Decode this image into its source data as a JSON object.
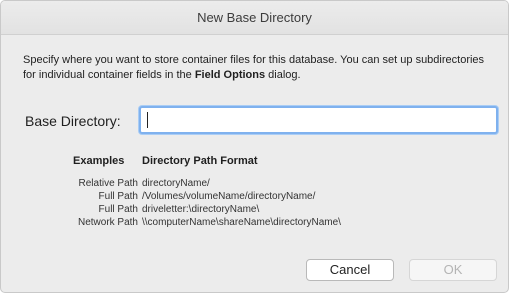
{
  "dialog": {
    "title": "New Base Directory",
    "description_part1": "Specify where you want to store container files for this database. You can set up subdirectories for individual container fields in the ",
    "description_bold": "Field Options",
    "description_part2": " dialog."
  },
  "base_directory": {
    "label": "Base Directory:",
    "value": ""
  },
  "examples": {
    "header_label": "Examples",
    "header_format": "Directory Path Format",
    "rows": [
      {
        "type": "Relative Path",
        "format": "directoryName/"
      },
      {
        "type": "Full Path",
        "format": "/Volumes/volumeName/directoryName/"
      },
      {
        "type": "Full Path",
        "format": "driveletter:\\directoryName\\"
      },
      {
        "type": "Network Path",
        "format": "\\\\computerName\\shareName\\directoryName\\"
      }
    ]
  },
  "buttons": {
    "cancel_label": "Cancel",
    "ok_label": "OK"
  },
  "colors": {
    "focus_ring": "#7fb1ee",
    "ok_disabled_text": "#b4b4b4"
  }
}
